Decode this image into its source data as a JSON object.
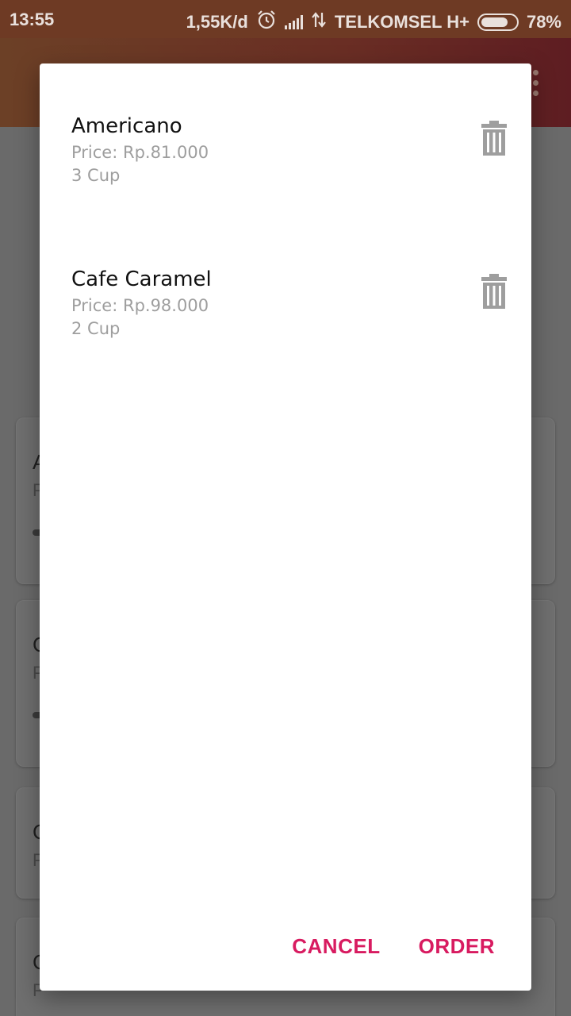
{
  "status_bar": {
    "time": "13:55",
    "speed": "1,55K/d",
    "carrier": "TELKOMSEL H+",
    "battery": "78%",
    "battery_level": 0.78
  },
  "background_cards": [
    {
      "title": "A",
      "price": "P"
    },
    {
      "title": "C",
      "price": "P"
    },
    {
      "title": "C",
      "price": "P"
    },
    {
      "title": "C",
      "price": "P"
    }
  ],
  "dialog": {
    "items": [
      {
        "name": "Americano",
        "price": "Price: Rp.81.000",
        "qty": "3 Cup"
      },
      {
        "name": "Cafe Caramel",
        "price": "Price: Rp.98.000",
        "qty": "2 Cup"
      }
    ],
    "cancel_label": "CANCEL",
    "order_label": "ORDER"
  },
  "colors": {
    "accent": "#d81b60",
    "icon_gray": "#9e9e9e"
  }
}
